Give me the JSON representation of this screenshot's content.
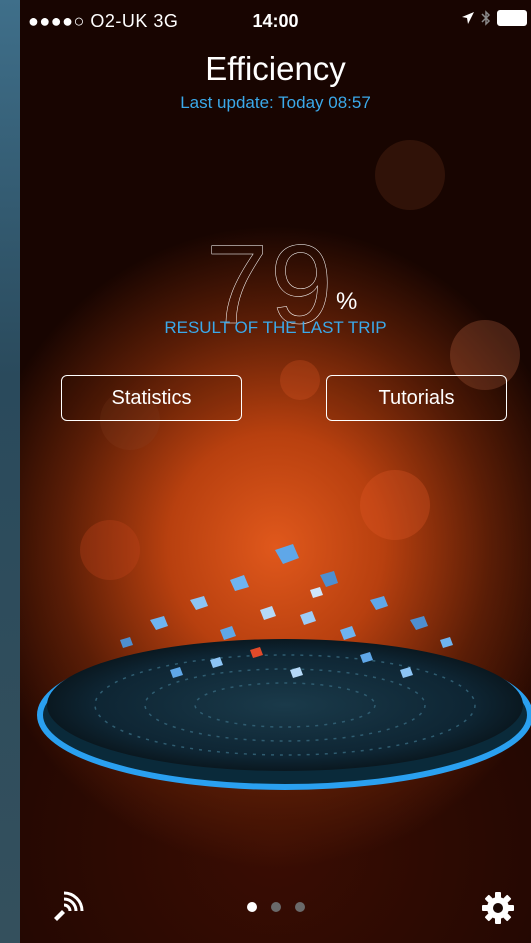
{
  "status_bar": {
    "carrier": "●●●●○ O2-UK  3G",
    "time": "14:00"
  },
  "header": {
    "title": "Efficiency",
    "last_update": "Last update: Today 08:57"
  },
  "result": {
    "value": "79",
    "unit": "%",
    "label": "RESULT OF THE LAST TRIP"
  },
  "buttons": {
    "statistics": "Statistics",
    "tutorials": "Tutorials"
  },
  "pager": {
    "pages": 3,
    "active": 0
  },
  "icons": {
    "left_bottom": "bluetooth-connect-icon",
    "right_bottom": "gear-icon"
  },
  "colors": {
    "accent": "#3ba9ea",
    "glow": "#e0581c"
  }
}
